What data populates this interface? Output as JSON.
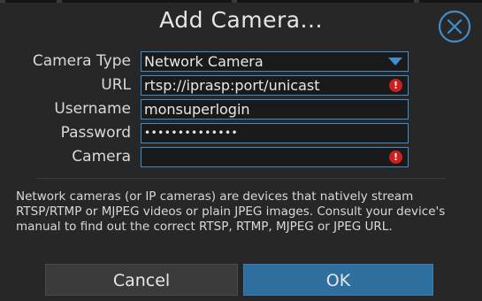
{
  "dialog": {
    "title": "Add Camera..."
  },
  "form": {
    "camera_type": {
      "label": "Camera Type",
      "value": "Network Camera"
    },
    "url": {
      "label": "URL",
      "value": "rtsp://iprasp:port/unicast",
      "error": true
    },
    "username": {
      "label": "Username",
      "value": "monsuperlogin"
    },
    "password": {
      "label": "Password",
      "value": "••••••••••••••"
    },
    "camera": {
      "label": "Camera",
      "value": "",
      "error": true
    }
  },
  "help_text": "Network cameras (or IP cameras) are devices that natively stream RTSP/RTMP or MJPEG videos or plain JPEG images. Consult your device's manual to find out the correct RTSP, RTMP, MJPEG or JPEG URL.",
  "buttons": {
    "cancel_label": "Cancel",
    "ok_label": "OK"
  },
  "icons": {
    "close": "close-icon",
    "dropdown": "chevron-down-icon",
    "error": "error-icon"
  },
  "colors": {
    "accent": "#3f8ecb",
    "error": "#cc1f1f",
    "ok_button": "#2f6f9f",
    "background": "#272727"
  }
}
